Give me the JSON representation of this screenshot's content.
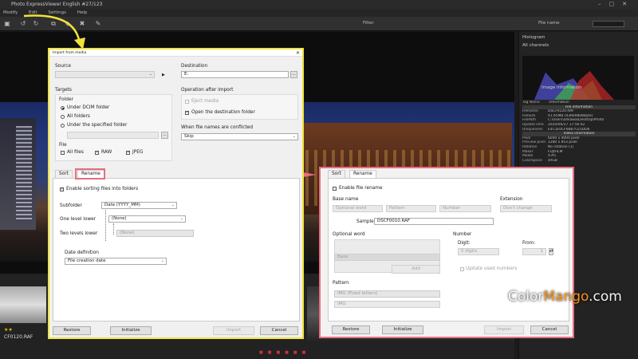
{
  "app": {
    "title": "Photo ExpressViewer English  #27/123",
    "menu": [
      "Modify",
      "Edit",
      "Settings",
      "Help"
    ],
    "toolbar": {
      "filter_label": "Filter",
      "sort_label": "File name"
    }
  },
  "right_panel": {
    "histogram_title": "Histogram",
    "histogram_sub": "All channels",
    "info_title": "Image information",
    "info_header": {
      "tag": "Tag Name",
      "info": "Information"
    },
    "rows": [
      {
        "type": "sec",
        "text": "File information"
      },
      {
        "k": "Filename",
        "v": "DSCF0120.RAF"
      },
      {
        "k": "FileSize",
        "v": "41.65MB (43669808Byte)"
      },
      {
        "k": "FilePath",
        "v": "C:\\Users\\ohkawa\\Desktop\\Photo"
      },
      {
        "k": "UpdateTime",
        "v": "2020/06/27 17:56:42"
      },
      {
        "k": "Uniqueness",
        "v": "E4C1E0CF6BB7CE5DD6"
      },
      {
        "type": "sec",
        "text": "Video information"
      },
      {
        "k": "Pixel",
        "v": "6000 x 4000 pixel"
      },
      {
        "k": "Preview pixel",
        "v": "1280 x 853 pixel"
      },
      {
        "k": "Rotation",
        "v": "No rotation (1)"
      },
      {
        "k": "Maker",
        "v": "FUJIFILM"
      },
      {
        "k": "Model",
        "v": "X-A5"
      },
      {
        "k": "ColorSpace",
        "v": "sRGB"
      }
    ]
  },
  "filmstrip": {
    "stars": "★★",
    "filename": "CF0120.RAF"
  },
  "watermark": {
    "part1": "Color",
    "part2": "Mango",
    "part3": ".com"
  },
  "import_dialog": {
    "title": "Import from media",
    "source_label": "Source",
    "destination_label": "Destination",
    "destination_value": "E:",
    "browse_label": "...",
    "targets_label": "Targets",
    "folder_label": "Folder",
    "radio_dcim": "Under DCIM folder",
    "radio_all": "All folders",
    "radio_specified": "Under the specified folder",
    "file_label": "File",
    "chk_all": "All files",
    "chk_raw": "RAW",
    "chk_jpeg": "JPEG",
    "op_label": "Operation after import",
    "eject_label": "Eject media",
    "open_dest_label": "Open the destination folder",
    "conflict_label": "When file names are conflicted",
    "conflict_value": "Skip",
    "tab_sort": "Sort",
    "tab_rename": "Rename",
    "enable_sorting": "Enable sorting files into folders",
    "subfolder_label": "Subfolder",
    "subfolder_value": "Date (YYYY_MM)",
    "one_level_label": "One level lower",
    "one_level_value": "(None)",
    "two_levels_label": "Two levels lower",
    "two_levels_value": "(None)",
    "date_def_label": "Date definition",
    "date_def_value": "File creation date",
    "restore": "Restore",
    "initialize": "Initialize",
    "import": "Import",
    "cancel": "Cancel"
  },
  "rename_dialog": {
    "tab_sort": "Sort",
    "tab_rename": "Rename",
    "enable_rename": "Enable file rename",
    "base_name_label": "Base name",
    "extension_label": "Extension",
    "base_opt_word": "Optional word",
    "base_pattern": "Pattern",
    "base_number": "Number",
    "ext_value": "Don't change",
    "sample_label": "Sample",
    "sample_value": "DSCF0010.RAF",
    "optional_word_label": "Optional word",
    "opt_selected": "Base",
    "add_btn": "Add",
    "number_label": "Number",
    "digit_label": "Digit:",
    "digit_value": "5 digits",
    "from_label": "From:",
    "from_value": "1",
    "update_used": "Update used numbers",
    "pattern_label": "Pattern",
    "pattern_value": "IMG (Fixed letters)",
    "pattern_text": "IMG",
    "restore": "Restore",
    "initialize": "Initialize",
    "import": "Import",
    "cancel": "Cancel"
  },
  "colors": {
    "highlight_yellow": "#f0e23a",
    "highlight_pink": "#e86d7e",
    "watermark_orange": "#f7931e"
  }
}
